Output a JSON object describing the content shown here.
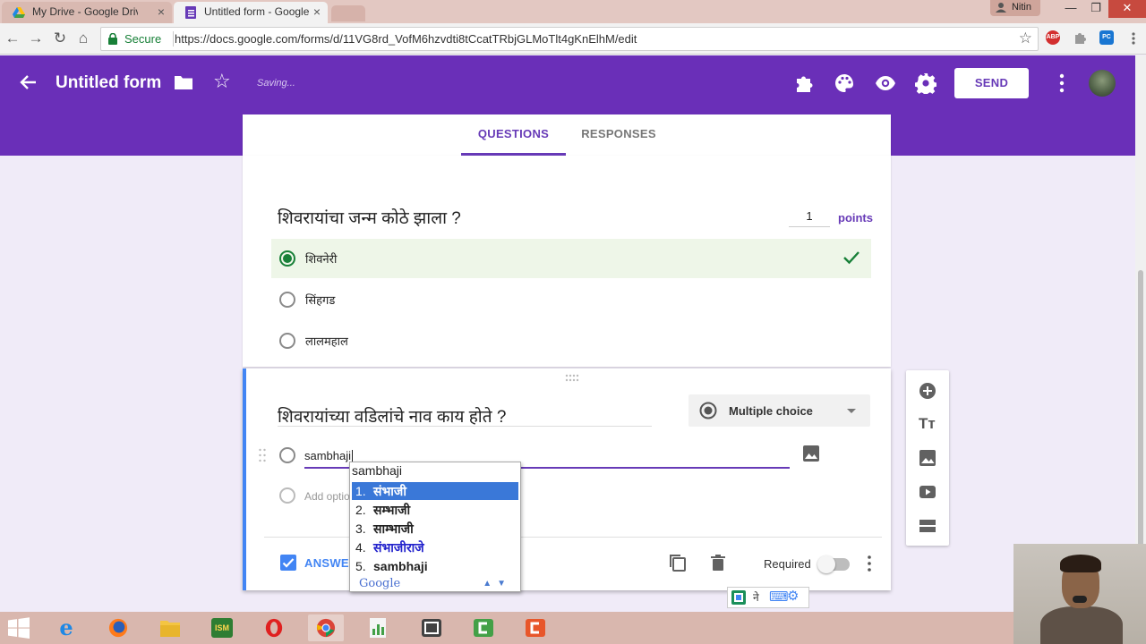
{
  "browser": {
    "tabs": [
      {
        "title": "My Drive - Google Drive",
        "close": "×"
      },
      {
        "title": "Untitled form - Google F",
        "close": "×"
      }
    ],
    "user": "Nitin",
    "window_controls": {
      "minimize": "—",
      "maximize": "❐",
      "close": "✕"
    },
    "nav": {
      "back": "←",
      "forward": "→",
      "reload": "↻",
      "home": "⌂"
    },
    "secure_label": "Secure",
    "url": "https://docs.google.com/forms/d/11VG8rd_VofM6hzvdti8tCcatTRbjGLMoTlt4gKnElhM/edit",
    "bookmark_star": "☆",
    "extensions": [
      "ABP",
      "PC"
    ]
  },
  "header": {
    "title": "Untitled form",
    "star": "☆",
    "saving": "Saving...",
    "send_label": "SEND"
  },
  "form_tabs": {
    "questions": "QUESTIONS",
    "responses": "RESPONSES"
  },
  "question1": {
    "text": "शिवरायांचा जन्म कोठे झाला ?",
    "points_value": "1",
    "points_label": "points",
    "options": [
      {
        "label": "शिवनेरी",
        "correct": true
      },
      {
        "label": "सिंहगड",
        "correct": false
      },
      {
        "label": "लालमहाल",
        "correct": false
      }
    ]
  },
  "question2": {
    "text": "शिवरायांच्या वडिलांचे नाव काय होते ?",
    "type": "Multiple choice",
    "option_value": "sambhaji",
    "add_option": "Add option",
    "answer_key": "ANSWER KEY",
    "required_label": "Required",
    "required_on": false
  },
  "transliteration": {
    "input": "sambhaji",
    "suggestions": [
      {
        "n": "1.",
        "word": "संभाजी"
      },
      {
        "n": "2.",
        "word": "सम्भाजी"
      },
      {
        "n": "3.",
        "word": "साम्भाजी"
      },
      {
        "n": "4.",
        "word": "संभाजीराजे"
      },
      {
        "n": "5.",
        "word": "sambhaji"
      }
    ],
    "selected_index": 0,
    "logo": "Google",
    "arrows": "▲▼"
  },
  "ime_widget": {
    "lang_char": "ने",
    "keyboard": "⌨",
    "gear": "⚙"
  },
  "side_toolbar": {
    "title_text_label": "Tт"
  },
  "taskbar": {
    "apps": [
      "Internet Explorer",
      "Firefox",
      "File Explorer",
      "Cisco ISM",
      "Opera",
      "Chrome",
      "Charts",
      "Camtasia Recorder",
      "Camtasia Studio",
      "Camtasia"
    ],
    "cisco_label": "ISM"
  },
  "colors": {
    "header_purple": "#6a2fb8",
    "accent_purple": "#673ab7",
    "active_blue": "#4285f4",
    "correct_green": "#188038",
    "page_bg": "#f0ebf8"
  }
}
